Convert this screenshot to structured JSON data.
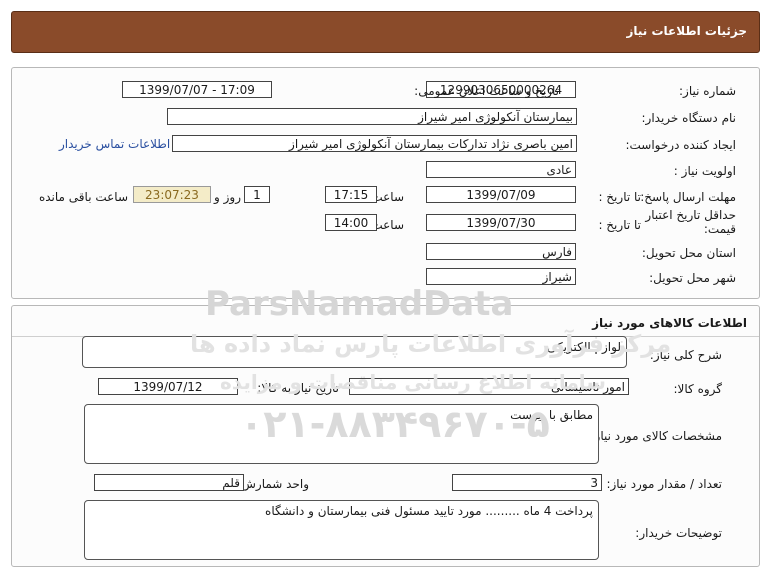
{
  "header": {
    "title": "جزئیات اطلاعات نیاز"
  },
  "need_info": {
    "need_number": {
      "label": "شماره نیاز:",
      "value": "1299030650000264"
    },
    "announce_datetime": {
      "label": "تاریخ و ساعت اعلان عمومی:",
      "value": "1399/07/07 - 17:09"
    },
    "buyer_org": {
      "label": "نام دستگاه خریدار:",
      "value": "بیمارستان آنکولوژی امیر شیراز"
    },
    "requester": {
      "label": "ایجاد کننده درخواست:",
      "value": "امین باصری نژاد تدارکات بیمارستان آنکولوژی امیر شیراز"
    },
    "contact_link": "اطلاعات تماس خریدار",
    "priority": {
      "label": "اولویت نیاز :",
      "value": "عادی"
    },
    "reply_deadline": {
      "label": "مهلت ارسال پاسخ:",
      "to_date_label": "تا تاریخ :",
      "date": "1399/07/09",
      "time_label": "ساعت",
      "time": "17:15",
      "days": "1",
      "days_label": "روز و",
      "remaining": "23:07:23",
      "remaining_label": "ساعت باقی مانده"
    },
    "price_validity": {
      "label": "حداقل تاریخ اعتبار قیمت:",
      "to_date_label": "تا تاریخ :",
      "date": "1399/07/30",
      "time_label": "ساعت",
      "time": "14:00"
    },
    "province": {
      "label": "استان محل تحویل:",
      "value": "فارس"
    },
    "city": {
      "label": "شهر محل تحویل:",
      "value": "شیراز"
    }
  },
  "goods": {
    "title": "اطلاعات کالاهای مورد نیاز",
    "description": {
      "label": "شرح کلی نیاز:",
      "value": "لوازم الکتریکی"
    },
    "group": {
      "label": "گروه کالا:",
      "value": "امور تاسیساتی"
    },
    "need_date": {
      "label": "تاریخ نیاز به کالا:",
      "value": "1399/07/12"
    },
    "specs": {
      "label": "مشخصات کالای مورد نیاز:",
      "value": "مطابق با پیوست"
    },
    "quantity": {
      "label": "تعداد / مقدار مورد نیاز:",
      "value": "3"
    },
    "unit": {
      "label": "واحد شمارش:",
      "value": "قلم"
    },
    "buyer_notes": {
      "label": "توضیحات خریدار:",
      "value": "پرداخت 4 ماه ......... مورد تایید مسئول فنی بیمارستان و دانشگاه"
    }
  },
  "watermark": {
    "brand": "ParsNamadData",
    "line1": "مرکز فرآوری اطلاعات پارس نماد داده ها",
    "line2": "سامانه اطلاع رسانی مناقصات و مزایده",
    "phone": "۰۲۱-۸۸۳۴۹۶۷۰-۵"
  },
  "colors": {
    "header_bg": "#8a4b2a",
    "link": "#2a4fa0",
    "remaining_bg": "#f4ecc8"
  }
}
